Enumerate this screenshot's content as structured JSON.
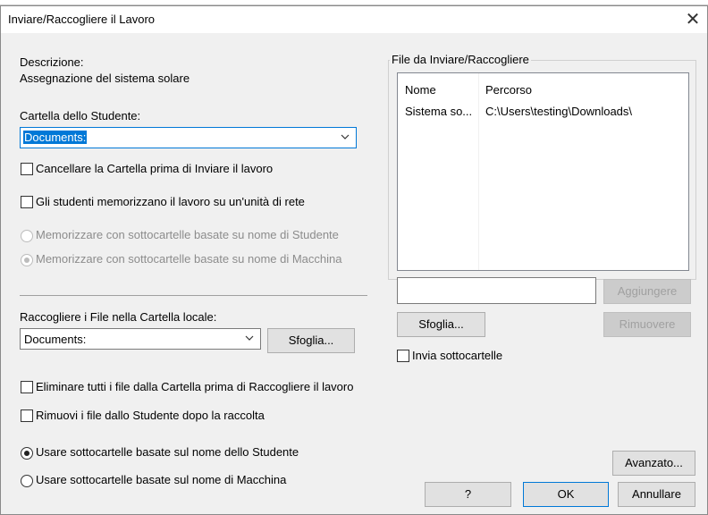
{
  "dialog": {
    "title": "Inviare/Raccogliere il Lavoro",
    "close_glyph": "✕"
  },
  "description": {
    "label": "Descrizione:",
    "value": "Assegnazione del sistema solare"
  },
  "student_folder": {
    "label": "Cartella dello Studente:",
    "value": "Documents:"
  },
  "options_send": {
    "clear_before_send": {
      "label": "Cancellare la Cartella prima di Inviare il lavoro",
      "checked": false
    },
    "network_drive": {
      "label": "Gli studenti memorizzano il lavoro su un'unità di rete",
      "checked": false
    },
    "radio_student_name": {
      "label": "Memorizzare con sottocartelle basate su nome di Studente",
      "selected": false,
      "enabled": false
    },
    "radio_machine_name": {
      "label": "Memorizzare con sottocartelle basate su nome di Macchina",
      "selected": true,
      "enabled": false
    }
  },
  "local_folder": {
    "label": "Raccogliere i File nella Cartella locale:",
    "value": "Documents:",
    "browse_label": "Sfoglia..."
  },
  "options_collect": {
    "delete_all_before": {
      "label": "Eliminare tutti i file dalla Cartella prima di Raccogliere il lavoro",
      "checked": false
    },
    "remove_from_student": {
      "label": "Rimuovi i file dallo Studente dopo la raccolta",
      "checked": false
    },
    "radio_student_subfolders": {
      "label": "Usare sottocartelle basate sul nome dello Studente",
      "selected": true
    },
    "radio_machine_subfolders": {
      "label": "Usare sottocartelle basate sul nome di Macchina",
      "selected": false
    }
  },
  "files_group": {
    "label": "File da Inviare/Raccogliere",
    "columns": [
      "Nome",
      "Percorso"
    ],
    "rows": [
      {
        "name": "Sistema so...",
        "path": "C:\\Users\\testing\\Downloads\\"
      }
    ],
    "path_input_value": "",
    "add_label": "Aggiungere",
    "browse_label": "Sfoglia...",
    "remove_label": "Rimuovere",
    "send_subfolders": {
      "label": "Invia sottocartelle",
      "checked": false
    }
  },
  "buttons": {
    "advanced": "Avanzato...",
    "help": "?",
    "ok": "OK",
    "cancel": "Annullare"
  },
  "colors": {
    "dialog_bg": "#f0f0f0",
    "accent": "#0078d7"
  }
}
